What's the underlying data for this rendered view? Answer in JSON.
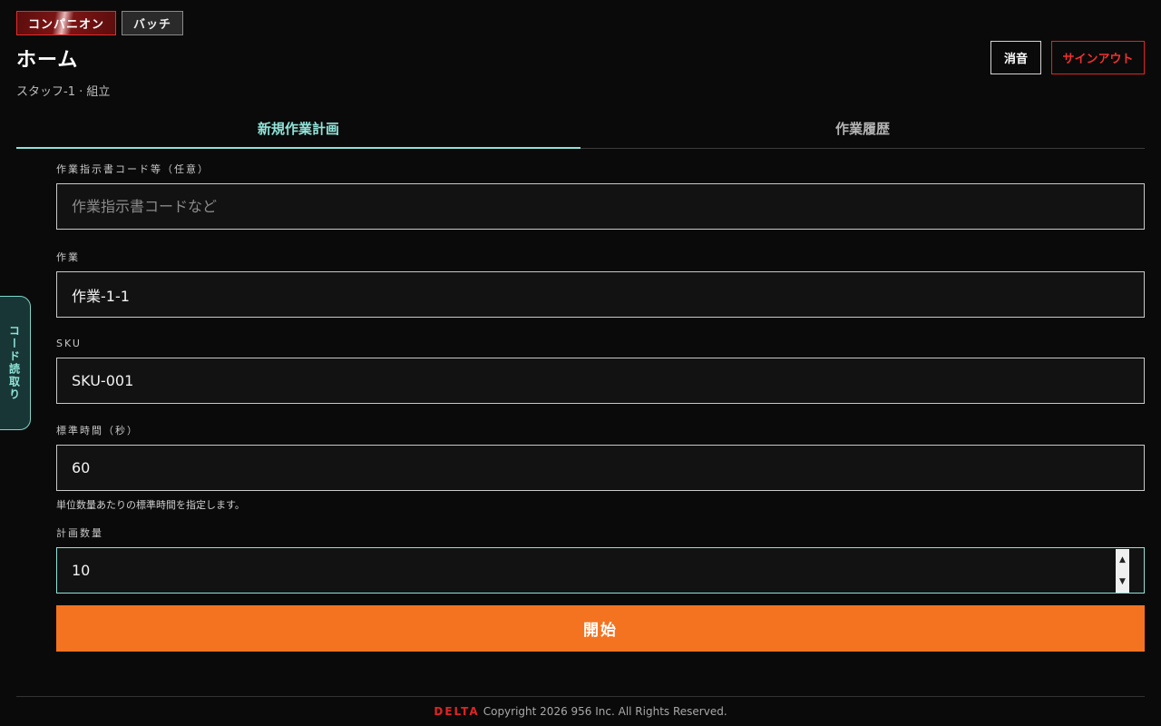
{
  "mode_toggle": {
    "companion_label": "コンパニオン",
    "batch_label": "バッチ"
  },
  "header": {
    "title": "ホーム",
    "user_info": "スタッフ-1 · 組立",
    "mute_label": "消音",
    "signout_label": "サインアウト"
  },
  "tabs": [
    {
      "label": "新規作業計画",
      "active": true
    },
    {
      "label": "作業履歴",
      "active": false
    }
  ],
  "side_tab": {
    "label": "コード読取り"
  },
  "form": {
    "work_order": {
      "label": "作業指示書コード等（任意）",
      "placeholder": "作業指示書コードなど",
      "value": ""
    },
    "task": {
      "label": "作業",
      "value": "作業-1-1"
    },
    "sku": {
      "label": "SKU",
      "value": "SKU-001"
    },
    "standard_time": {
      "label": "標準時間（秒）",
      "value": "60",
      "help": "単位数量あたりの標準時間を指定します。"
    },
    "planned_qty": {
      "label": "計画数量",
      "value": "10"
    },
    "start_label": "開始"
  },
  "footer": {
    "brand": "DELTA",
    "copyright": "Copyright 2026 956 Inc. All Rights Reserved."
  },
  "colors": {
    "accent_teal": "#8fe3d8",
    "danger_red": "#e02424",
    "start_orange": "#f37321",
    "background": "#0a0a0a"
  }
}
